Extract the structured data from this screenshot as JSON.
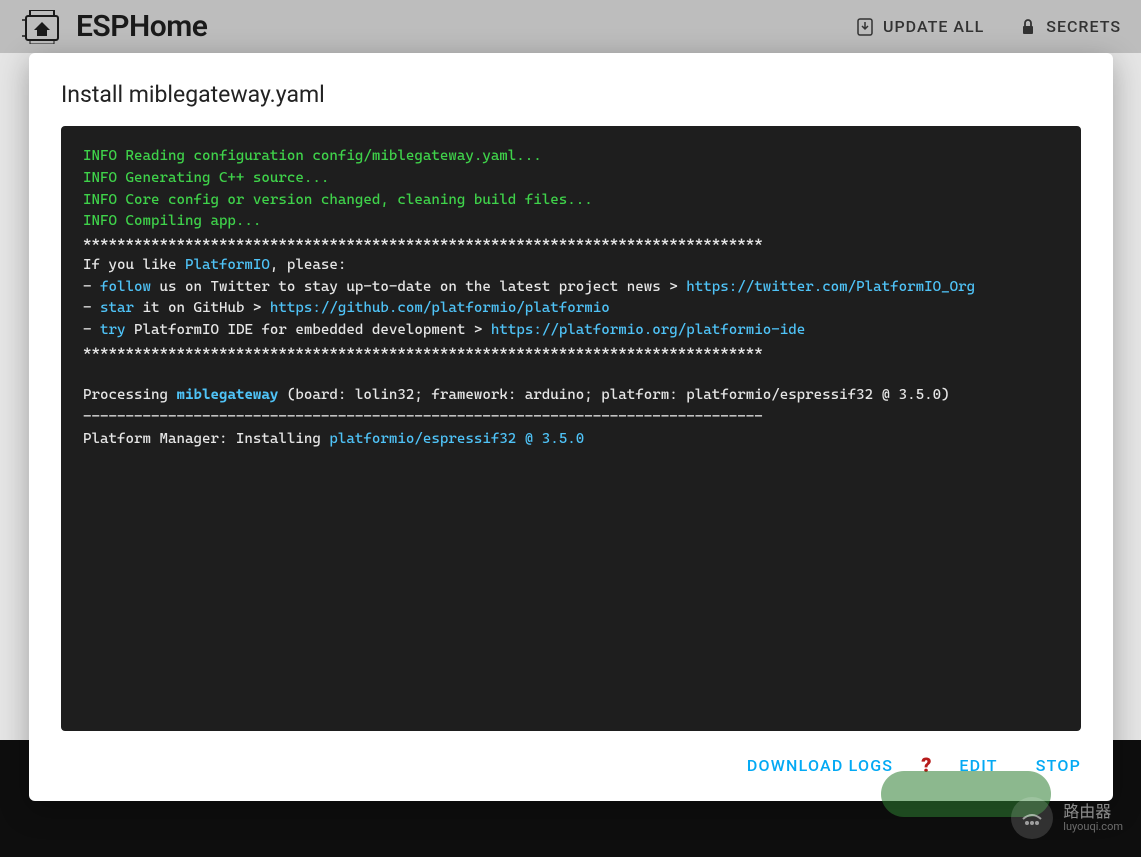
{
  "brand": "ESPHome",
  "topbar": {
    "update_all": "UPDATE ALL",
    "secrets": "SECRETS"
  },
  "dialog": {
    "title": "Install miblegateway.yaml"
  },
  "terminal": {
    "info1": "INFO Reading configuration config/miblegateway.yaml...",
    "info2": "INFO Generating C++ source...",
    "info3": "INFO Core config or version changed, cleaning build files...",
    "info4": "INFO Compiling app...",
    "hr1": "********************************************************************************",
    "like_prefix": "If you like ",
    "platformio": "PlatformIO",
    "like_suffix": ", please:",
    "follow_dash": "- ",
    "follow": "follow",
    "follow_text": " us on Twitter to stay up-to-date on the latest project news > ",
    "follow_url": "https://twitter.com/PlatformIO_Org",
    "star_dash": "- ",
    "star": "star",
    "star_text": " it on GitHub > ",
    "star_url": "https://github.com/platformio/platformio",
    "try_dash": "- ",
    "try": "try",
    "try_text": " PlatformIO IDE for embedded development > ",
    "try_url": "https://platformio.org/platformio-ide",
    "hr2": "********************************************************************************",
    "blank": "",
    "proc_prefix": "Processing ",
    "proc_name": "miblegateway",
    "proc_suffix": " (board: lolin32; framework: arduino; platform: platformio/espressif32 @ 3.5.0)",
    "dashline": "--------------------------------------------------------------------------------",
    "pm_prefix": "Platform Manager: Installing ",
    "pm_pkg": "platformio/espressif32 @ 3.5.0"
  },
  "actions": {
    "download_logs": "DOWNLOAD LOGS",
    "edit": "EDIT",
    "stop": "STOP"
  },
  "watermark": {
    "main": "路由器",
    "sub": "luyouqi.com"
  }
}
